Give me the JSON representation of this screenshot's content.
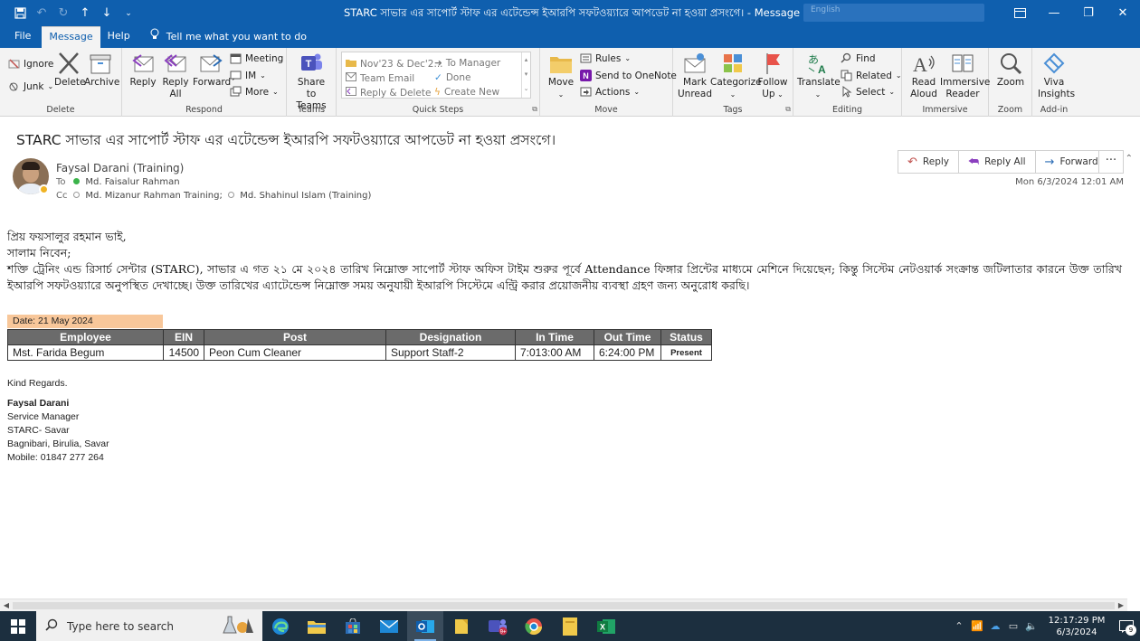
{
  "window": {
    "title": "STARC  সাভার এর  সাপোর্ট স্টাফ এর এটেন্ডেন্স ইআরপি সফটওয়্যারে আপডেট না হওয়া প্রসংগে।  -  Message (HTML)",
    "search_hint": "English"
  },
  "menu": {
    "tabs": [
      "File",
      "Message",
      "Help"
    ],
    "tell_me": "Tell me what you want to do"
  },
  "ribbon": {
    "delete_group": {
      "label": "Delete",
      "ignore": "Ignore",
      "junk": "Junk",
      "delete": "Delete",
      "archive": "Archive"
    },
    "respond_group": {
      "label": "Respond",
      "reply": "Reply",
      "reply_all_1": "Reply",
      "reply_all_2": "All",
      "forward": "Forward",
      "meeting": "Meeting",
      "im": "IM",
      "more": "More"
    },
    "teams_group": {
      "label": "Teams",
      "share_1": "Share to",
      "share_2": "Teams"
    },
    "quicksteps_group": {
      "label": "Quick Steps",
      "items": [
        "Nov'23 & Dec'2...",
        "To Manager",
        "Team Email",
        "Done",
        "Reply & Delete",
        "Create New"
      ]
    },
    "move_group": {
      "label": "Move",
      "move": "Move",
      "rules": "Rules",
      "onenote": "Send to OneNote",
      "actions": "Actions"
    },
    "tags_group": {
      "label": "Tags",
      "mark_1": "Mark",
      "mark_2": "Unread",
      "categorize": "Categorize",
      "follow_1": "Follow",
      "follow_2": "Up"
    },
    "editing_group": {
      "label": "Editing",
      "translate": "Translate",
      "find": "Find",
      "related": "Related",
      "select": "Select"
    },
    "immersive_group": {
      "label": "Immersive",
      "read_1": "Read",
      "read_2": "Aloud",
      "ir_1": "Immersive",
      "ir_2": "Reader"
    },
    "zoom_group": {
      "label": "Zoom",
      "zoom": "Zoom"
    },
    "addin_group": {
      "label": "Add-in",
      "viva_1": "Viva",
      "viva_2": "Insights"
    }
  },
  "message": {
    "subject": "STARC  সাভার এর  সাপোর্ট স্টাফ এর এটেন্ডেন্স ইআরপি সফটওয়্যারে আপডেট না হওয়া প্রসংগে।",
    "sender": "Faysal Darani (Training)",
    "to_label": "To",
    "to": "Md. Faisalur Rahman",
    "cc_label": "Cc",
    "cc_1": "Md. Mizanur Rahman Training;",
    "cc_2": "Md. Shahinul Islam (Training)",
    "date": "Mon 6/3/2024 12:01 AM",
    "actions": {
      "reply": "Reply",
      "reply_all": "Reply All",
      "forward": "Forward",
      "more": "···"
    }
  },
  "body": {
    "greeting": "প্রিয় ফয়সালুর রহমান ভাই,",
    "salam": "সালাম নিবেন;",
    "paragraph": "শক্তি ট্রেনিং এন্ড রিসার্চ সেন্টার (STARC), সাভার এ গত ২১ মে ২০২৪ তারিখ নিম্নোক্ত  সাপোর্ট স্টাফ অফিস টাইম শুরুর পূর্বে Attendance ফিঙ্গার প্রিন্টের মাধ্যমে মেশিনে দিয়েছেন; কিন্তু সিস্টেম নেটওয়ার্ক সংক্রান্ত জটিলাতার কারনে উক্ত তারিখ ইআরপি সফটওয়্যারে অনুপস্থিত দেখাচ্ছে। উক্ত তারিখের এ্যাটেন্ডেন্স নিম্নোক্ত সময় অনুযায়ী ইআরপি সিস্টেমে এন্ট্রি করার প্রয়োজনীয় ব্যবস্থা গ্রহণ জন্য অনুরোধ করছি।"
  },
  "attendance": {
    "date_label": "Date: 21 May 2024",
    "headers": [
      "Employee",
      "EIN",
      "Post",
      "Designation",
      "In Time",
      "Out Time",
      "Status"
    ],
    "row": [
      "Mst. Farida Begum",
      "14500",
      "Peon Cum Cleaner",
      "Support Staff-2",
      "7:013:00 AM",
      "6:24:00 PM",
      "Present"
    ]
  },
  "signature": {
    "regards": "Kind Regards.",
    "name": "Faysal Darani",
    "title": "Service Manager",
    "org": "STARC- Savar",
    "address": "Bagnibari, Birulia, Savar",
    "mobile": "Mobile: 01847 277 264"
  },
  "taskbar": {
    "search_placeholder": "Type here to search",
    "time": "12:17:29 PM",
    "date": "6/3/2024",
    "notif_count": "9"
  }
}
